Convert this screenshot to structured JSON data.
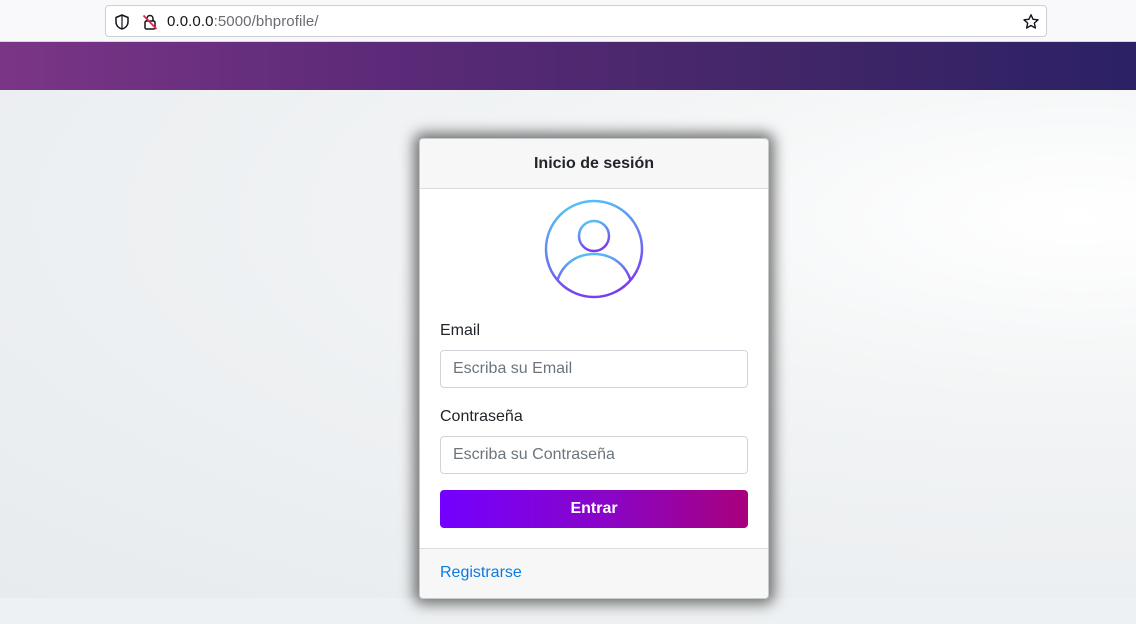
{
  "browser": {
    "url_host": "0.0.0.0",
    "url_rest": ":5000/bhprofile/",
    "icons": [
      "shield-icon",
      "insecure-lock-icon",
      "bookmark-star-icon"
    ]
  },
  "login": {
    "title": "Inicio de sesión",
    "email_label": "Email",
    "email_placeholder": "Escriba su Email",
    "password_label": "Contraseña",
    "password_placeholder": "Escriba su Contraseña",
    "submit_label": "Entrar",
    "register_link": "Registrarse",
    "avatar_icon": "user-avatar-icon"
  },
  "colors": {
    "navbar_start": "#7b3587",
    "navbar_end": "#2b2164",
    "button_start": "#7300ff",
    "button_end": "#a8007c",
    "link": "#0d7ae0",
    "avatar_start": "#4fd0f5",
    "avatar_end": "#7a3ef0"
  }
}
